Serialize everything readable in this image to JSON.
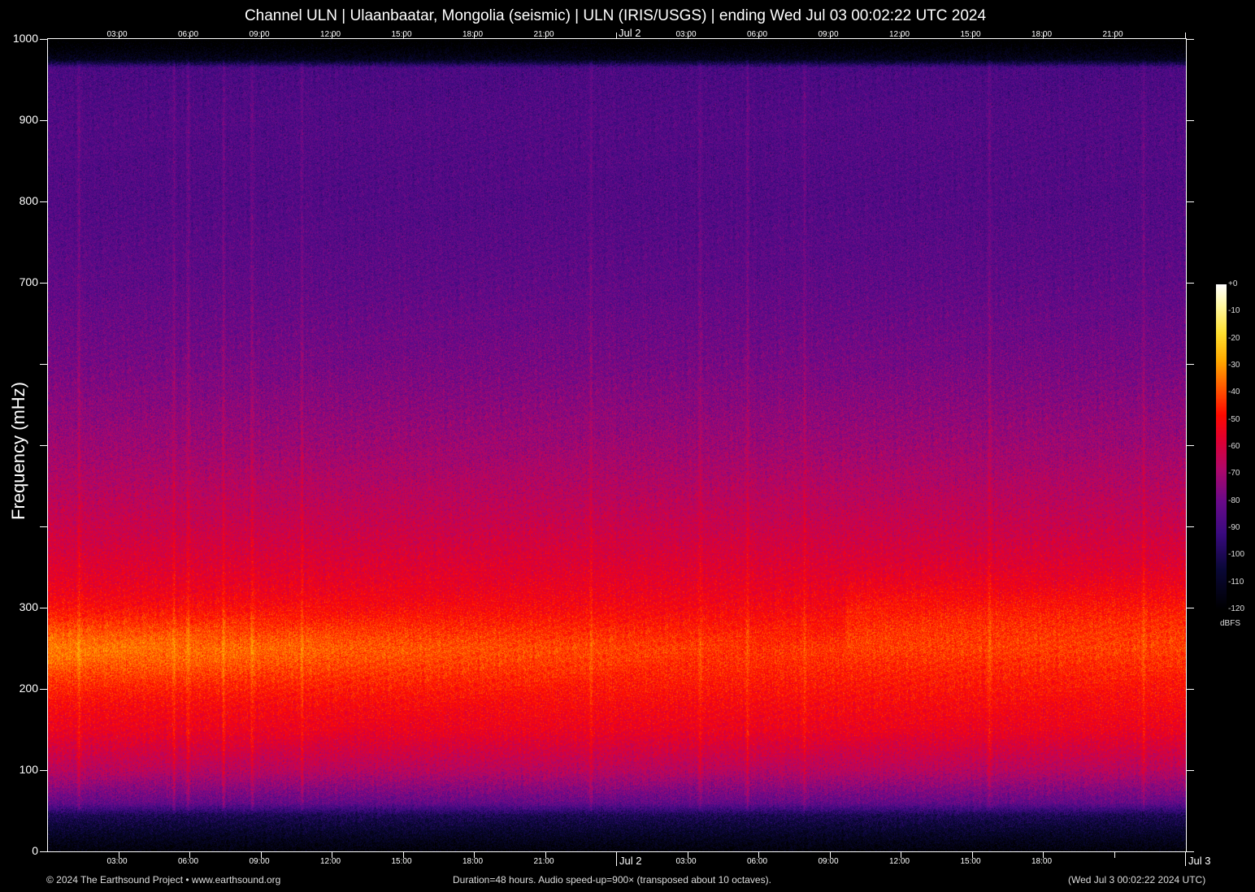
{
  "chart_data": {
    "type": "heatmap",
    "title": "Channel ULN | Ulaanbaatar, Mongolia (seismic) | ULN (IRIS/USGS) | ending Wed Jul 03 00:02:22 UTC 2024",
    "ylabel": "Frequency (mHz)",
    "ylim": [
      0,
      1000
    ],
    "xlim_hours": [
      0,
      48
    ],
    "y_ticks": [
      {
        "value": 0,
        "label": "0"
      },
      {
        "value": 100,
        "label": "100"
      },
      {
        "value": 200,
        "label": "200"
      },
      {
        "value": 300,
        "label": "300"
      },
      {
        "value": 400,
        "label": ""
      },
      {
        "value": 500,
        "label": ""
      },
      {
        "value": 600,
        "label": ""
      },
      {
        "value": 700,
        "label": "700"
      },
      {
        "value": 800,
        "label": "800"
      },
      {
        "value": 900,
        "label": "900"
      },
      {
        "value": 1000,
        "label": "1000"
      }
    ],
    "x_ticks_top": [
      {
        "hour": 3,
        "label": "03:00"
      },
      {
        "hour": 6,
        "label": "06:00"
      },
      {
        "hour": 9,
        "label": "09:00"
      },
      {
        "hour": 12,
        "label": "12:00"
      },
      {
        "hour": 15,
        "label": "15:00"
      },
      {
        "hour": 18,
        "label": "18:00"
      },
      {
        "hour": 21,
        "label": "21:00"
      },
      {
        "hour": 24,
        "label": "Jul  2",
        "day": true
      },
      {
        "hour": 27,
        "label": "03:00"
      },
      {
        "hour": 30,
        "label": "06:00"
      },
      {
        "hour": 33,
        "label": "09:00"
      },
      {
        "hour": 36,
        "label": "12:00"
      },
      {
        "hour": 39,
        "label": "15:00"
      },
      {
        "hour": 42,
        "label": "18:00"
      },
      {
        "hour": 45,
        "label": "21:00"
      },
      {
        "hour": 48,
        "label": ""
      }
    ],
    "x_ticks_bottom": [
      {
        "hour": 3,
        "label": "03:00"
      },
      {
        "hour": 6,
        "label": "06:00"
      },
      {
        "hour": 9,
        "label": "09:00"
      },
      {
        "hour": 12,
        "label": "12:00"
      },
      {
        "hour": 15,
        "label": "15:00"
      },
      {
        "hour": 18,
        "label": "18:00"
      },
      {
        "hour": 21,
        "label": "21:00"
      },
      {
        "hour": 24,
        "label": "Jul  2",
        "day": true
      },
      {
        "hour": 27,
        "label": "03:00"
      },
      {
        "hour": 30,
        "label": "06:00"
      },
      {
        "hour": 33,
        "label": "09:00"
      },
      {
        "hour": 36,
        "label": "12:00"
      },
      {
        "hour": 39,
        "label": "15:00"
      },
      {
        "hour": 42,
        "label": "18:00"
      },
      {
        "hour": 45,
        "label": ""
      },
      {
        "hour": 48,
        "label": "Jul  3",
        "day": true
      }
    ],
    "intensity_profile_dbfs": {
      "frequency_mhz": [
        0,
        20,
        45,
        60,
        100,
        150,
        200,
        250,
        300,
        350,
        400,
        500,
        600,
        700,
        800,
        900,
        965,
        975,
        1000
      ],
      "level": [
        -118,
        -110,
        -100,
        -82,
        -66,
        -54,
        -49,
        -46,
        -52,
        -57,
        -62,
        -71,
        -78,
        -83,
        -86,
        -86,
        -88,
        -112,
        -125
      ]
    },
    "bright_band": {
      "center_mhz": 250,
      "width_mhz": 45,
      "peak_gain_db_start": 12,
      "peak_gain_db_end": 3
    },
    "events_hours": [
      1.3,
      5.3,
      5.9,
      7.4,
      8.6,
      10.7,
      22.9,
      27.5,
      29.5,
      31.9,
      39.7,
      46.2
    ],
    "colorbar": {
      "unit": "dBFS",
      "range": [
        -120,
        0
      ],
      "tick_labels": [
        "+0",
        "-10",
        "-20",
        "-30",
        "-40",
        "-50",
        "-60",
        "-70",
        "-80",
        "-90",
        "-100",
        "-110",
        "-120"
      ],
      "stops": [
        {
          "db": -120,
          "color": "#000000"
        },
        {
          "db": -105,
          "color": "#0a0838"
        },
        {
          "db": -92,
          "color": "#3a0a80"
        },
        {
          "db": -80,
          "color": "#6a0a8a"
        },
        {
          "db": -68,
          "color": "#b0086a"
        },
        {
          "db": -57,
          "color": "#e00030"
        },
        {
          "db": -48,
          "color": "#ff0a00"
        },
        {
          "db": -38,
          "color": "#ff5a00"
        },
        {
          "db": -28,
          "color": "#ffaa00"
        },
        {
          "db": -18,
          "color": "#ffe030"
        },
        {
          "db": -8,
          "color": "#fff8a0"
        },
        {
          "db": 0,
          "color": "#ffffff"
        }
      ]
    }
  },
  "footer": {
    "copyright": "© 2024 The Earthsound Project • www.earthsound.org",
    "duration": "Duration=48 hours. Audio speed-up=900× (transposed about 10 octaves).",
    "timestamp": "(Wed Jul  3 00:02:22 2024 UTC)"
  }
}
